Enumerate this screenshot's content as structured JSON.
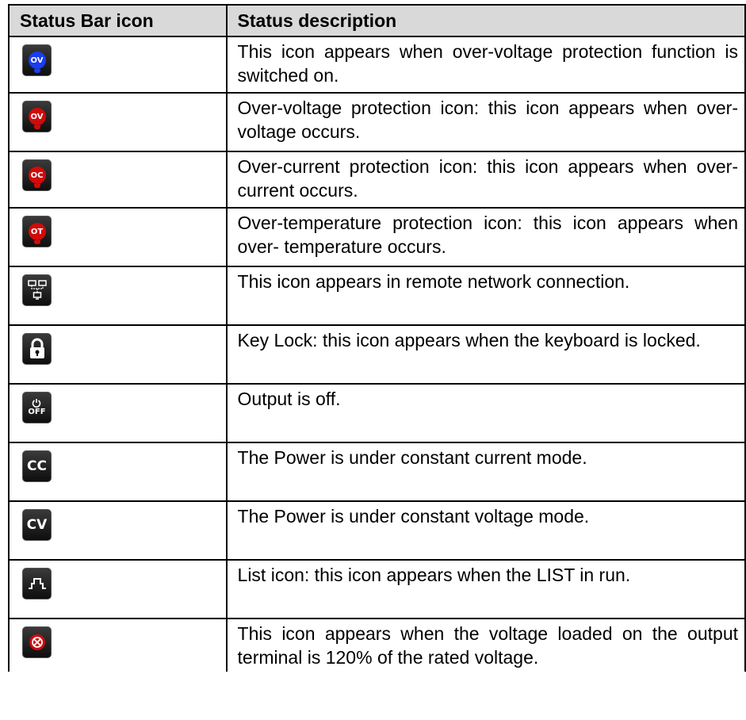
{
  "headers": {
    "icon": "Status Bar icon",
    "description": "Status description"
  },
  "rows": [
    {
      "icon": "ov-blue-icon",
      "icon_text": "OV",
      "description": "This icon appears when over-voltage protection function is switched on."
    },
    {
      "icon": "ov-red-icon",
      "icon_text": "OV",
      "description": "Over-voltage protection icon: this icon appears when over-voltage occurs."
    },
    {
      "icon": "oc-red-icon",
      "icon_text": "OC",
      "description": "Over-current protection icon: this icon appears when over-current occurs."
    },
    {
      "icon": "ot-red-icon",
      "icon_text": "OT",
      "description": "Over-temperature protection icon: this icon appears when over- temperature occurs."
    },
    {
      "icon": "network-icon",
      "description": "This icon appears in remote network connection."
    },
    {
      "icon": "lock-icon",
      "description": "Key Lock: this icon appears when the keyboard is locked."
    },
    {
      "icon": "power-off-icon",
      "icon_text": "OFF",
      "description": "Output is off."
    },
    {
      "icon": "cc-icon",
      "icon_text": "CC",
      "description": "The Power is under constant current mode."
    },
    {
      "icon": "cv-icon",
      "icon_text": "CV",
      "description": "The Power is under constant voltage mode."
    },
    {
      "icon": "list-icon",
      "description": "List icon: this icon appears when the LIST in run."
    },
    {
      "icon": "overvoltage-120-icon",
      "description": "This icon appears when the voltage loaded on the output terminal is 120% of the rated voltage."
    }
  ],
  "colors": {
    "header_bg": "#d9d9d9",
    "red": "#d10a0a",
    "blue": "#1a3df0",
    "icon_bg": "#1a1a1a"
  }
}
